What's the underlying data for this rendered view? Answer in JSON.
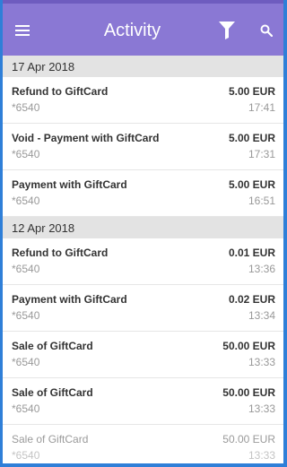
{
  "header": {
    "title": "Activity",
    "menu_icon": "menu-icon",
    "filter_icon": "filter-icon",
    "search_icon": "search-icon",
    "color": "#8a78d4"
  },
  "groups": [
    {
      "date": "17 Apr 2018",
      "items": [
        {
          "description": "Refund to GiftCard",
          "card": "*6540",
          "amount": "5.00 EUR",
          "time": "17:41"
        },
        {
          "description": "Void - Payment with GiftCard",
          "card": "*6540",
          "amount": "5.00 EUR",
          "time": "17:31"
        },
        {
          "description": "Payment with GiftCard",
          "card": "*6540",
          "amount": "5.00 EUR",
          "time": "16:51"
        }
      ]
    },
    {
      "date": "12 Apr 2018",
      "items": [
        {
          "description": "Refund to GiftCard",
          "card": "*6540",
          "amount": "0.01 EUR",
          "time": "13:36"
        },
        {
          "description": "Payment with GiftCard",
          "card": "*6540",
          "amount": "0.02 EUR",
          "time": "13:34"
        },
        {
          "description": "Sale of GiftCard",
          "card": "*6540",
          "amount": "50.00 EUR",
          "time": "13:33"
        },
        {
          "description": "Sale of GiftCard",
          "card": "*6540",
          "amount": "50.00 EUR",
          "time": "13:33"
        },
        {
          "description": "Sale of GiftCard",
          "card": "*6540",
          "amount": "50.00 EUR",
          "time": "13:33"
        }
      ]
    }
  ]
}
